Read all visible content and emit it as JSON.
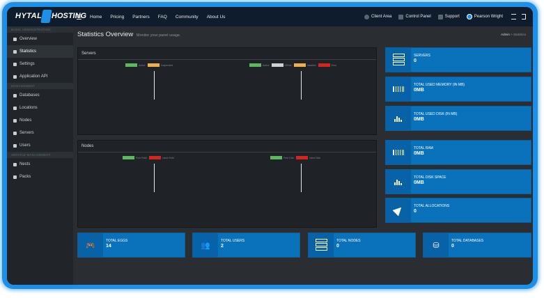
{
  "topbar": {
    "logo_left": "HYTALE",
    "logo_right": "HOSTING",
    "nav": [
      "Home",
      "Pricing",
      "Partners",
      "FAQ",
      "Community",
      "About Us"
    ],
    "right": {
      "client_area": "Client Area",
      "control_panel": "Control Panel",
      "support": "Support",
      "user": "Pearson Wright"
    }
  },
  "sidebar": {
    "sections": [
      {
        "header": "BASIC ADMINISTRATION",
        "items": [
          {
            "label": "Overview",
            "icon": "home-icon"
          },
          {
            "label": "Statistics",
            "icon": "chart-icon",
            "active": true
          },
          {
            "label": "Settings",
            "icon": "wrench-icon"
          },
          {
            "label": "Application API",
            "icon": "api-icon"
          }
        ]
      },
      {
        "header": "MANAGEMENT",
        "items": [
          {
            "label": "Databases",
            "icon": "database-icon"
          },
          {
            "label": "Locations",
            "icon": "globe-icon"
          },
          {
            "label": "Nodes",
            "icon": "sitemap-icon"
          },
          {
            "label": "Servers",
            "icon": "server-icon"
          },
          {
            "label": "Users",
            "icon": "users-icon"
          }
        ]
      },
      {
        "header": "SERVICE MANAGEMENT",
        "items": [
          {
            "label": "Nests",
            "icon": "th-icon"
          },
          {
            "label": "Packs",
            "icon": "archive-icon"
          }
        ]
      }
    ]
  },
  "page": {
    "title": "Statistics Overview",
    "subtitle": "Monitor your panel usage.",
    "breadcrumb": [
      "Admin",
      "Statistics"
    ]
  },
  "panels": {
    "servers": {
      "title": "Servers",
      "legend_left": [
        {
          "label": "Active",
          "color": "#5cb85c"
        },
        {
          "label": "Suspended",
          "color": "#f0ad4e"
        }
      ],
      "legend_right": [
        {
          "label": "Active",
          "color": "#5cb85c"
        },
        {
          "label": "Offline",
          "color": "#d0d0d0"
        },
        {
          "label": "Installed",
          "color": "#f0ad4e"
        },
        {
          "label": "Error",
          "color": "#d9241d"
        }
      ]
    },
    "nodes": {
      "title": "Nodes",
      "legend_left": [
        {
          "label": "Free RAM",
          "color": "#5cb85c"
        },
        {
          "label": "Used RAM",
          "color": "#d9241d"
        }
      ],
      "legend_right": [
        {
          "label": "Free Disk",
          "color": "#5cb85c"
        },
        {
          "label": "Used Disk",
          "color": "#d9241d"
        }
      ]
    }
  },
  "stats_right": [
    {
      "label": "SERVERS",
      "value": "0",
      "icon": "server-icon"
    },
    {
      "label": "TOTAL USED MEMORY (IN MB)",
      "value": "0MB",
      "icon": "memory-icon"
    },
    {
      "label": "TOTAL USED DISK (IN MB)",
      "value": "0MB",
      "icon": "bar-chart-icon"
    },
    {
      "label": "TOTAL RAM",
      "value": "0MB",
      "icon": "memory-icon"
    },
    {
      "label": "TOTAL DISK SPACE",
      "value": "0MB",
      "icon": "bar-chart-icon"
    },
    {
      "label": "TOTAL ALLOCATIONS",
      "value": "0",
      "icon": "location-arrow-icon"
    }
  ],
  "stats_bottom": [
    {
      "label": "TOTAL EGGS",
      "value": "14",
      "icon": "gamepad-icon"
    },
    {
      "label": "TOTAL USERS",
      "value": "2",
      "icon": "users-icon"
    },
    {
      "label": "TOTAL NODES",
      "value": "0",
      "icon": "server-icon"
    },
    {
      "label": "TOTAL DATABASES",
      "value": "0",
      "icon": "database-icon"
    }
  ]
}
